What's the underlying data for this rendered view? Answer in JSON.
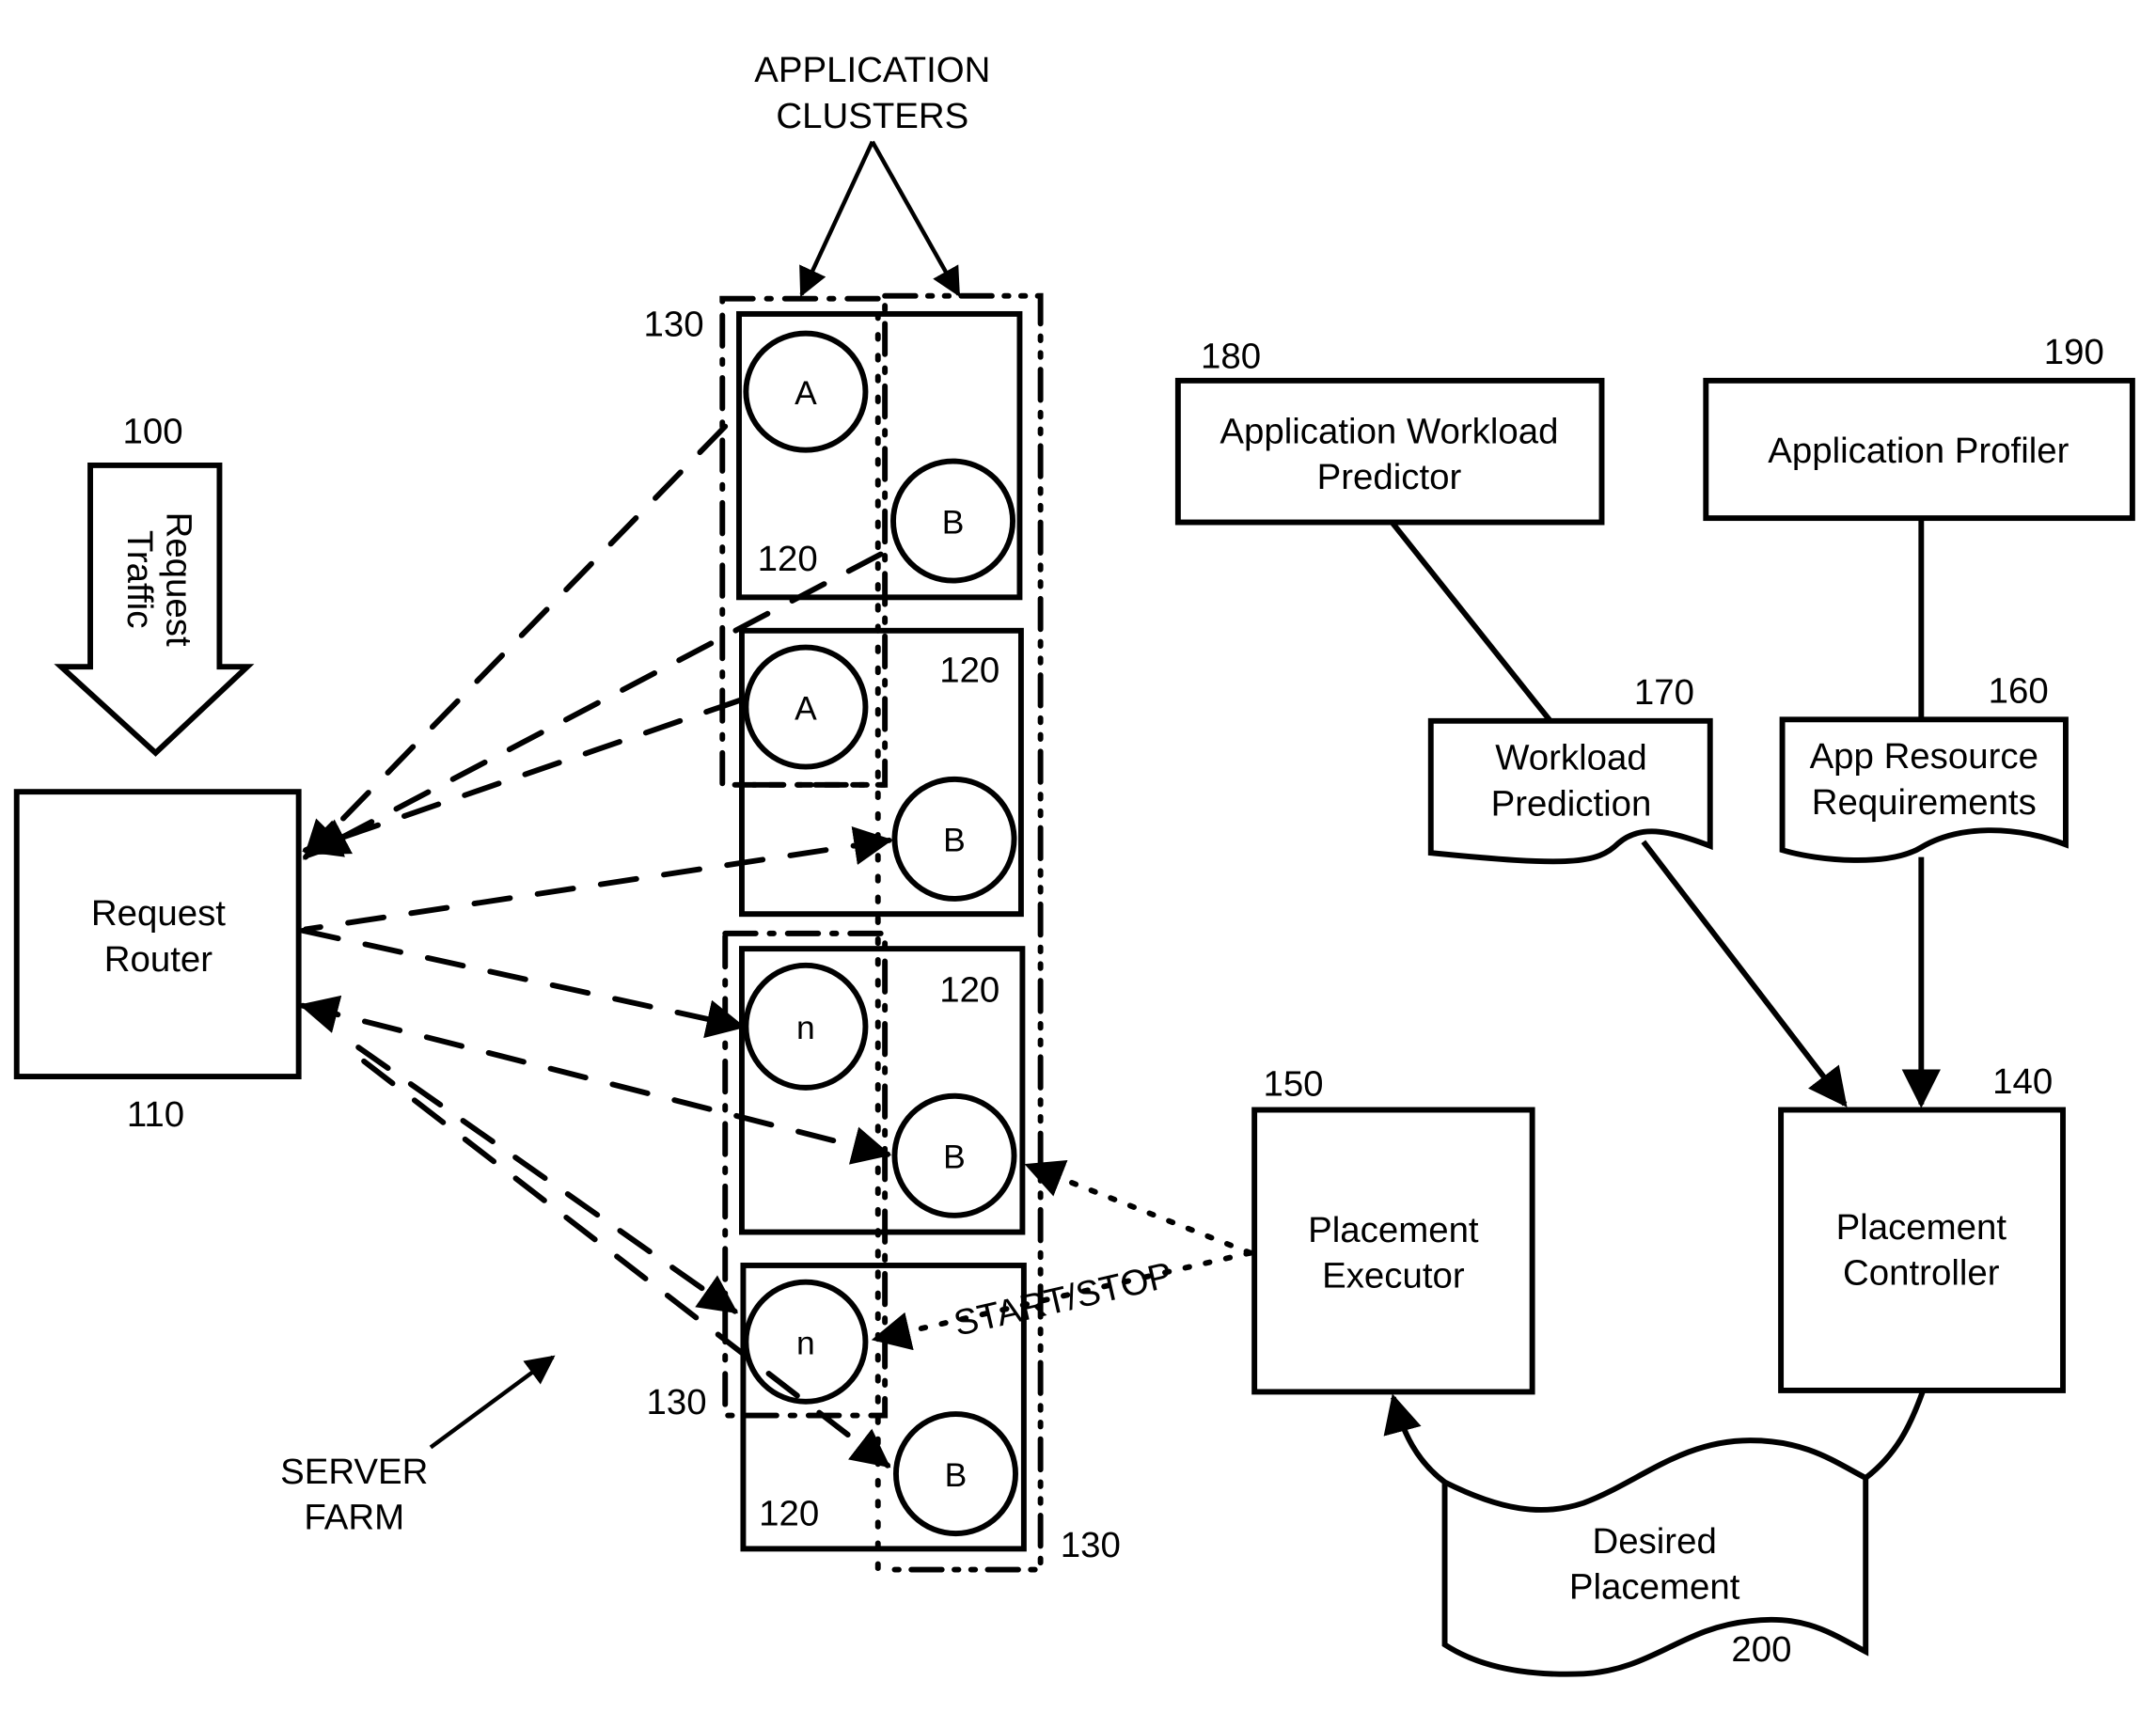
{
  "figure": {
    "app_clusters_label": [
      "APPLICATION",
      "CLUSTERS"
    ],
    "server_farm_label": [
      "SERVER",
      "FARM"
    ],
    "request_traffic": {
      "ref": "100",
      "label": [
        "Request",
        "Traffic"
      ]
    },
    "request_router": {
      "ref": "110",
      "label": [
        "Request",
        "Router"
      ]
    },
    "servers": {
      "ref": "120",
      "cluster_ref": "130",
      "rows": [
        {
          "left_app": "A",
          "right_app": "B"
        },
        {
          "left_app": "A",
          "right_app": "B"
        },
        {
          "left_app": "n",
          "right_app": "B"
        },
        {
          "left_app": "n",
          "right_app": "B"
        }
      ]
    },
    "start_stop_label": "START/STOP",
    "workload_predictor": {
      "ref": "180",
      "label": [
        "Application Workload",
        "Predictor"
      ]
    },
    "app_profiler": {
      "ref": "190",
      "label": [
        "Application Profiler"
      ]
    },
    "workload_prediction": {
      "ref": "170",
      "label": [
        "Workload",
        "Prediction"
      ]
    },
    "resource_requirements": {
      "ref": "160",
      "label": [
        "App Resource",
        "Requirements"
      ]
    },
    "placement_executor": {
      "ref": "150",
      "label": [
        "Placement",
        "Executor"
      ]
    },
    "placement_controller": {
      "ref": "140",
      "label": [
        "Placement",
        "Controller"
      ]
    },
    "desired_placement": {
      "ref": "200",
      "label": [
        "Desired",
        "Placement"
      ]
    }
  }
}
